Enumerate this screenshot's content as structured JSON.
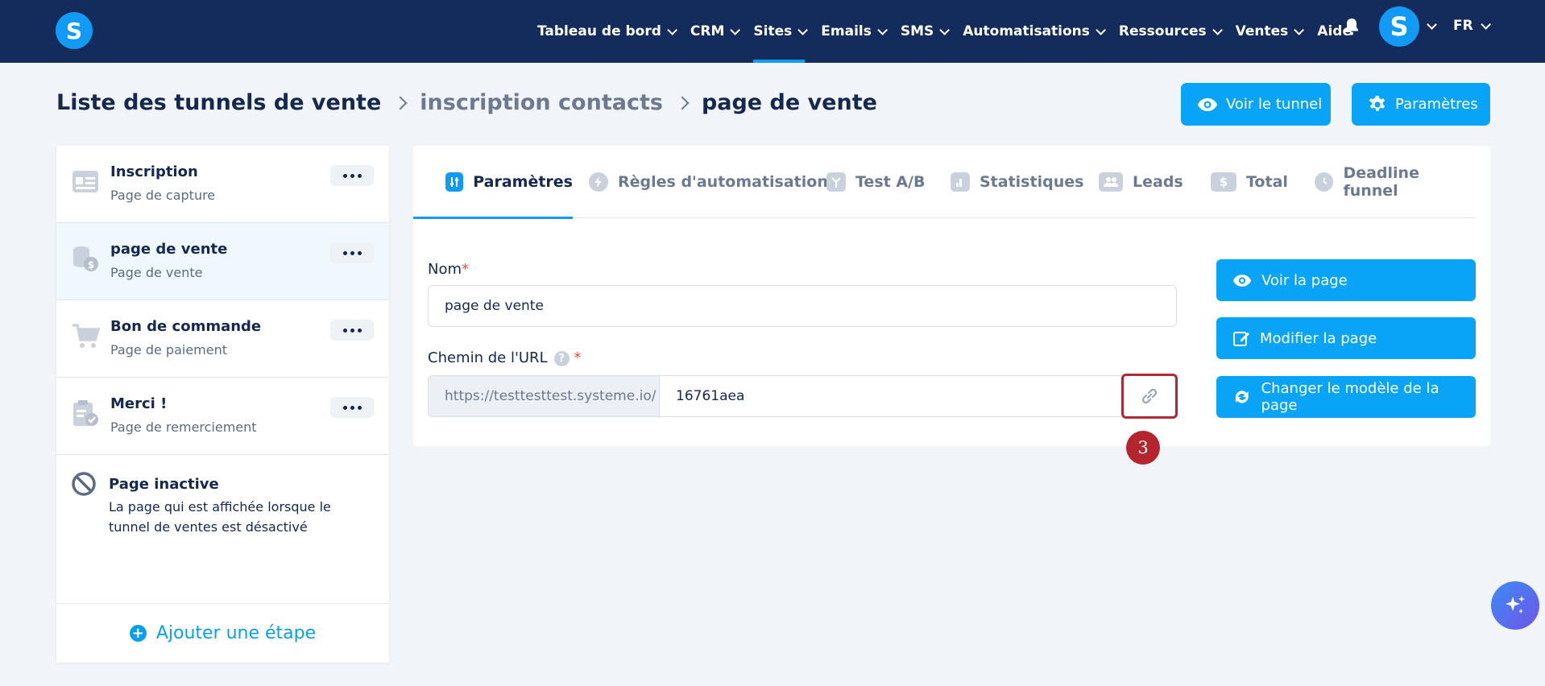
{
  "topnav": {
    "logo_letter": "S",
    "items": [
      {
        "label": "Tableau de bord",
        "dropdown": true
      },
      {
        "label": "CRM",
        "dropdown": true
      },
      {
        "label": "Sites",
        "dropdown": true,
        "active": true
      },
      {
        "label": "Emails",
        "dropdown": true
      },
      {
        "label": "SMS",
        "dropdown": true
      },
      {
        "label": "Automatisations",
        "dropdown": true
      },
      {
        "label": "Ressources",
        "dropdown": true
      },
      {
        "label": "Ventes",
        "dropdown": true
      },
      {
        "label": "Aide",
        "dropdown": false
      }
    ],
    "avatar_letter": "S",
    "language": "FR"
  },
  "breadcrumb": {
    "items": [
      "Liste des tunnels de vente",
      "inscription contacts",
      "page de vente"
    ]
  },
  "header_buttons": {
    "view_funnel": "Voir le tunnel",
    "settings": "Paramètres"
  },
  "sidebar": {
    "steps": [
      {
        "title": "Inscription",
        "subtitle": "Page de capture",
        "icon": "form-icon"
      },
      {
        "title": "page de vente",
        "subtitle": "Page de vente",
        "icon": "coins-icon",
        "selected": true
      },
      {
        "title": "Bon de commande",
        "subtitle": "Page de paiement",
        "icon": "cart-icon"
      },
      {
        "title": "Merci !",
        "subtitle": "Page de remerciement",
        "icon": "clipboard-check-icon"
      }
    ],
    "inactive": {
      "title": "Page inactive",
      "text": "La page qui est affichée lorsque le tunnel de ventes est désactivé"
    },
    "add_step": "Ajouter une étape"
  },
  "tabs": [
    {
      "label": "Paramètres",
      "active": true,
      "icon": "sliders-icon"
    },
    {
      "label": "Règles d'automatisation",
      "icon": "bolt-icon"
    },
    {
      "label": "Test A/B",
      "icon": "split-icon"
    },
    {
      "label": "Statistiques",
      "icon": "bar-chart-icon"
    },
    {
      "label": "Leads",
      "icon": "users-icon"
    },
    {
      "label": "Total",
      "icon": "dollar-icon"
    },
    {
      "label": "Deadline funnel",
      "icon": "clock-icon"
    }
  ],
  "form": {
    "name_label": "Nom",
    "name_value": "page de vente",
    "url_label": "Chemin de l'URL",
    "help_symbol": "?",
    "required_mark": "*",
    "url_prefix": "https://testtesttest.systeme.io/",
    "url_value": "16761aea"
  },
  "actions": {
    "view_page": "Voir la page",
    "edit_page": "Modifier la page",
    "change_template": "Changer le modèle de la page"
  },
  "annotation": {
    "step_number": "3"
  },
  "colors": {
    "navbar": "#142c5c",
    "primary": "#0aa4f6",
    "highlight": "#b2262f"
  }
}
